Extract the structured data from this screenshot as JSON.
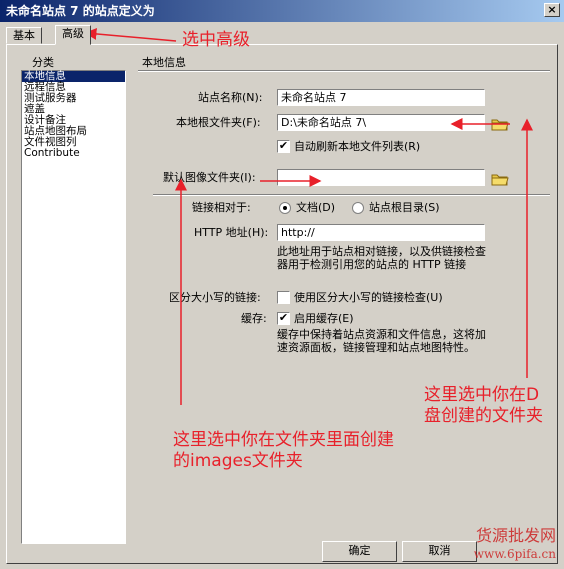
{
  "window": {
    "title": "未命名站点 7 的站点定义为",
    "close": "×"
  },
  "tabs": [
    {
      "label": "基本"
    },
    {
      "label": "高级"
    }
  ],
  "category": {
    "heading": "分类",
    "items": [
      "本地信息",
      "远程信息",
      "测试服务器",
      "遮盖",
      "设计备注",
      "站点地图布局",
      "文件视图列",
      "Contribute"
    ]
  },
  "section_title": "本地信息",
  "form": {
    "site_name_label": "站点名称(N):",
    "site_name_value": "未命名站点 7",
    "local_root_label": "本地根文件夹(F):",
    "local_root_value": "D:\\未命名站点 7\\",
    "auto_refresh_label": "自动刷新本地文件列表(R)",
    "auto_refresh_checked": true,
    "default_images_label": "默认图像文件夹(I):",
    "default_images_value": "",
    "links_relative_label": "链接相对于:",
    "radio_document": "文档(D)",
    "radio_site_root": "站点根目录(S)",
    "http_label": "HTTP 地址(H):",
    "http_value": "http://",
    "http_desc": "此地址用于站点相对链接，以及供链接检查器用于检测引用您的站点的 HTTP 链接",
    "case_label": "区分大小写的链接:",
    "case_check_label": "使用区分大小写的链接检查(U)",
    "case_checked": false,
    "cache_label": "缓存:",
    "cache_check_label": "启用缓存(E)",
    "cache_checked": true,
    "cache_desc": "缓存中保持着站点资源和文件信息，这将加速资源面板，链接管理和站点地图特性。"
  },
  "buttons": {
    "ok": "确定",
    "cancel": "取消"
  },
  "annotations": {
    "select_advanced": "选中高级",
    "select_d_drive": "这里选中你在D盘创建的文件夹",
    "select_images": "这里选中你在文件夹里面创建的images文件夹",
    "color": "#e8202a"
  },
  "watermark": {
    "line1": "货源批发网",
    "line2": "www.6pifa.cn"
  },
  "colors": {
    "title_bar": "#0a246a",
    "selection": "#0a246a",
    "dialog_bg": "#d4d0c8"
  }
}
